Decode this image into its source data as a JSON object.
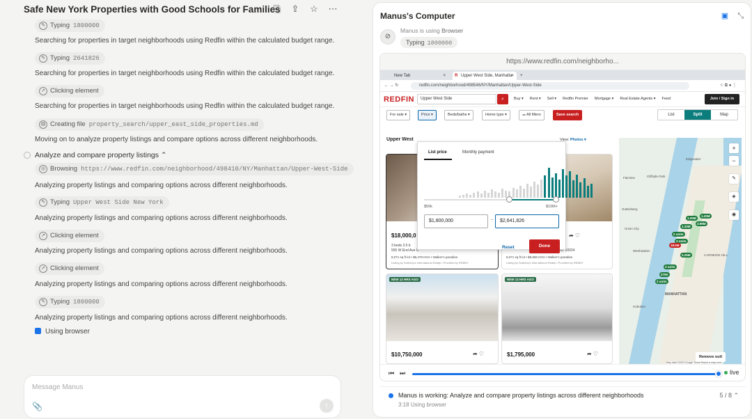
{
  "left": {
    "title": "Safe New York Properties with Good Schools for Families",
    "header_icons": [
      "share-out-icon",
      "upload-icon",
      "star-icon",
      "more-icon"
    ],
    "feed": [
      {
        "kind": "chip",
        "action": "Typing",
        "arg": "1800000",
        "icon": "pencil-icon"
      },
      {
        "kind": "text",
        "text": "Searching for properties in target neighborhoods using Redfin within the calculated budget range."
      },
      {
        "kind": "chip",
        "action": "Typing",
        "arg": "2641826",
        "icon": "pencil-icon"
      },
      {
        "kind": "text",
        "text": "Searching for properties in target neighborhoods using Redfin within the calculated budget range."
      },
      {
        "kind": "chip",
        "action": "Clicking element",
        "arg": "",
        "icon": "pointer-icon"
      },
      {
        "kind": "text",
        "text": "Searching for properties in target neighborhoods using Redfin within the calculated budget range."
      },
      {
        "kind": "chip",
        "action": "Creating file",
        "arg": "property_search/upper_east_side_properties.md",
        "icon": "file-icon"
      },
      {
        "kind": "text",
        "text": "Moving on to analyze property listings and compare options across different neighborhoods."
      },
      {
        "kind": "step",
        "text": "Analyze and compare property listings"
      },
      {
        "kind": "chip",
        "action": "Browsing",
        "arg": "https://www.redfin.com/neighborhood/498410/NY/Manhattan/Upper-West-Side",
        "icon": "globe-icon"
      },
      {
        "kind": "text",
        "text": "Analyzing property listings and comparing options across different neighborhoods."
      },
      {
        "kind": "chip",
        "action": "Typing",
        "arg": "Upper West Side New York",
        "icon": "pencil-icon"
      },
      {
        "kind": "text",
        "text": "Analyzing property listings and comparing options across different neighborhoods."
      },
      {
        "kind": "chip",
        "action": "Clicking element",
        "arg": "",
        "icon": "pointer-icon"
      },
      {
        "kind": "text",
        "text": "Analyzing property listings and comparing options across different neighborhoods."
      },
      {
        "kind": "chip",
        "action": "Clicking element",
        "arg": "",
        "icon": "pointer-icon"
      },
      {
        "kind": "text",
        "text": "Analyzing property listings and comparing options across different neighborhoods."
      },
      {
        "kind": "chip",
        "action": "Typing",
        "arg": "1800000",
        "icon": "pencil-icon"
      },
      {
        "kind": "text",
        "text": "Analyzing property listings and comparing options across different neighborhoods."
      },
      {
        "kind": "using",
        "text": "Using browser"
      }
    ],
    "message_placeholder": "Message Manus"
  },
  "right": {
    "title": "Manus's Computer",
    "using_prefix": "Manus is using",
    "using_tool": "Browser",
    "chip_action": "Typing",
    "chip_arg": "1800000",
    "url": "https://www.redfin.com/neighborho...",
    "browser": {
      "tabs": [
        "New Tab",
        "Upper West Side, Manhatta"
      ],
      "address": "redfin.com/neighborhood/498546/NY/Manhattan/Upper-West-Side",
      "logo": "REDFIN",
      "search_value": "Upper West Side",
      "nav": [
        "Buy ▾",
        "Rent ▾",
        "Sell ▾",
        "Redfin Premier",
        "Mortgage ▾",
        "Real Estate Agents ▾",
        "Feed"
      ],
      "join": "Join / Sign in",
      "filters": [
        "For sale ▾",
        "Price ▾",
        "Beds/baths ▾",
        "Home type ▾",
        "⚌ All filters"
      ],
      "save_search": "Save search",
      "views": [
        "List",
        "Split",
        "Map"
      ],
      "heading": "Upper West",
      "view_label": "View:",
      "view_value": "Photos ▾",
      "price_popup": {
        "tabs": [
          "List price",
          "Monthly payment"
        ],
        "min_label": "$50k",
        "max_label": "$10M+",
        "min_value": "$1,800,000",
        "max_value": "$2,641,826",
        "reset": "Reset",
        "done": "Done",
        "range_fraction": [
          0.64,
          1.0
        ]
      },
      "cards": [
        {
          "price": "$18,000,0",
          "beds": "3 beds",
          "baths": "3.5 b",
          "addr": "555 W End Ave U",
          "extra": "8,071 sq ft lot • $8,478 HOA • Walker's paradise",
          "listing": "Listing by Sotheby's International Realty • Provided by REBNY"
        },
        {
          "price": "",
          "beds": "",
          "baths": "",
          "addr": "York City, NY 10024",
          "extra": "8,071 sq ft lot • $8,868 HOA • Walker's paradise",
          "listing": "Listing by Sotheby's International Realty • Provided by REBNY"
        },
        {
          "price": "$10,750,000",
          "badge": "NEW 12 HRS AGO"
        },
        {
          "price": "$1,795,000",
          "badge": "NEW 13 HRS AGO"
        }
      ],
      "map": {
        "labels": [
          "Edgewater",
          "Fairview",
          "Cliffside Park",
          "Union City",
          "Weehawken",
          "Hoboken",
          "MANHATTAN",
          "CARNEGIE HILL",
          "Guttenberg",
          "Remove outl"
        ],
        "pins": [
          "1.20M",
          "3.99M",
          "1.33M",
          "1.20M",
          "2 units",
          "3 units",
          "18.0M",
          "2.25M",
          "3 units",
          "375K",
          "2 units"
        ],
        "footer": "Map data ©2023 Google  Terms  Report a map error"
      }
    },
    "live_label": "live",
    "status_text": "Manus is working: Analyze and compare property listings across different neighborhoods",
    "status_time": "3:18",
    "status_sub": "Using browser",
    "status_progress": "5 / 8"
  }
}
